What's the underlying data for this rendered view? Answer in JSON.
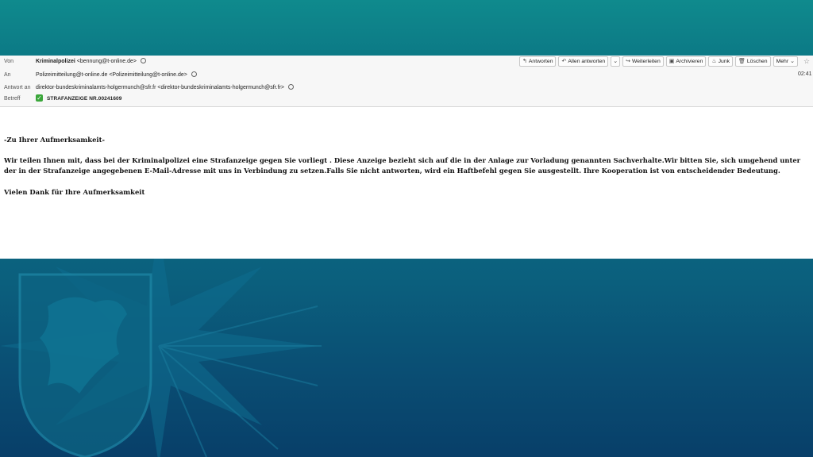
{
  "header": {
    "from_label": "Von",
    "from_name": "Kriminalpolizei",
    "from_address": "<bennung@t-online.de>",
    "to_label": "An",
    "to_value": "Polizeimitteilung@t-online.de <Polizeimitteilung@t-online.de>",
    "reply_to_label": "Antwort an",
    "reply_to_value": "direktor-bundeskriminalamts-holgermunch@sfr.fr <direktor-bundeskriminalamts-holgermunch@sfr.fr>",
    "subject_label": "Betreff",
    "subject_value": "STRAFANZEIGE NR.00241609",
    "time": "02:41"
  },
  "toolbar": {
    "reply": "Antworten",
    "reply_all": "Allen antworten",
    "forward": "Weiterleiten",
    "archive": "Archivieren",
    "junk": "Junk",
    "delete": "Löschen",
    "more": "Mehr"
  },
  "body": {
    "greeting": "-Zu Ihrer Aufmerksamkeit-",
    "paragraph": "Wir teilen Ihnen mit, dass bei der Kriminalpolizei eine Strafanzeige gegen Sie vorliegt . Diese Anzeige bezieht sich auf die in der Anlage zur Vorladung genannten Sachverhalte.Wir bitten Sie, sich umgehend unter der in der Strafanzeige angegebenen E-Mail-Adresse mit uns in Verbindung zu setzen.Falls Sie nicht antworten, wird ein Haftbefehl gegen Sie ausgestellt. Ihre Kooperation ist von entscheidender Bedeutung.",
    "closing": "Vielen Dank für Ihre Aufmerksamkeit"
  },
  "icons": {
    "reply": "reply-icon",
    "reply_all": "reply-all-icon",
    "forward": "forward-icon",
    "archive": "archive-icon",
    "junk": "junk-icon",
    "delete": "trash-icon",
    "star": "star-icon"
  }
}
